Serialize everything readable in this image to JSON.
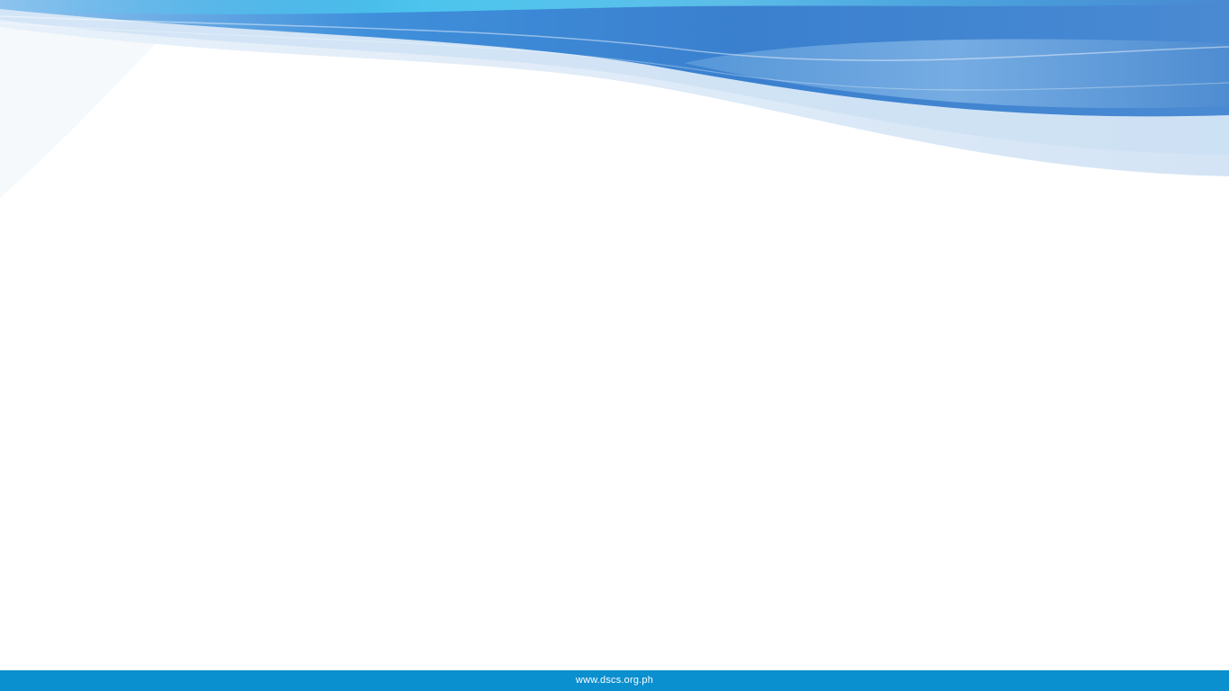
{
  "footer": {
    "url_text": "www.dscs.org.ph"
  },
  "colors": {
    "footer_bar": "#0a8fcf",
    "wave_dark": "#3f86d2",
    "wave_mid": "#6aa6e0",
    "wave_light": "#cfe1f4",
    "wave_highlight": "#4fd2f2"
  },
  "decorations": {
    "header_graphic": "blue-wave-banner"
  }
}
